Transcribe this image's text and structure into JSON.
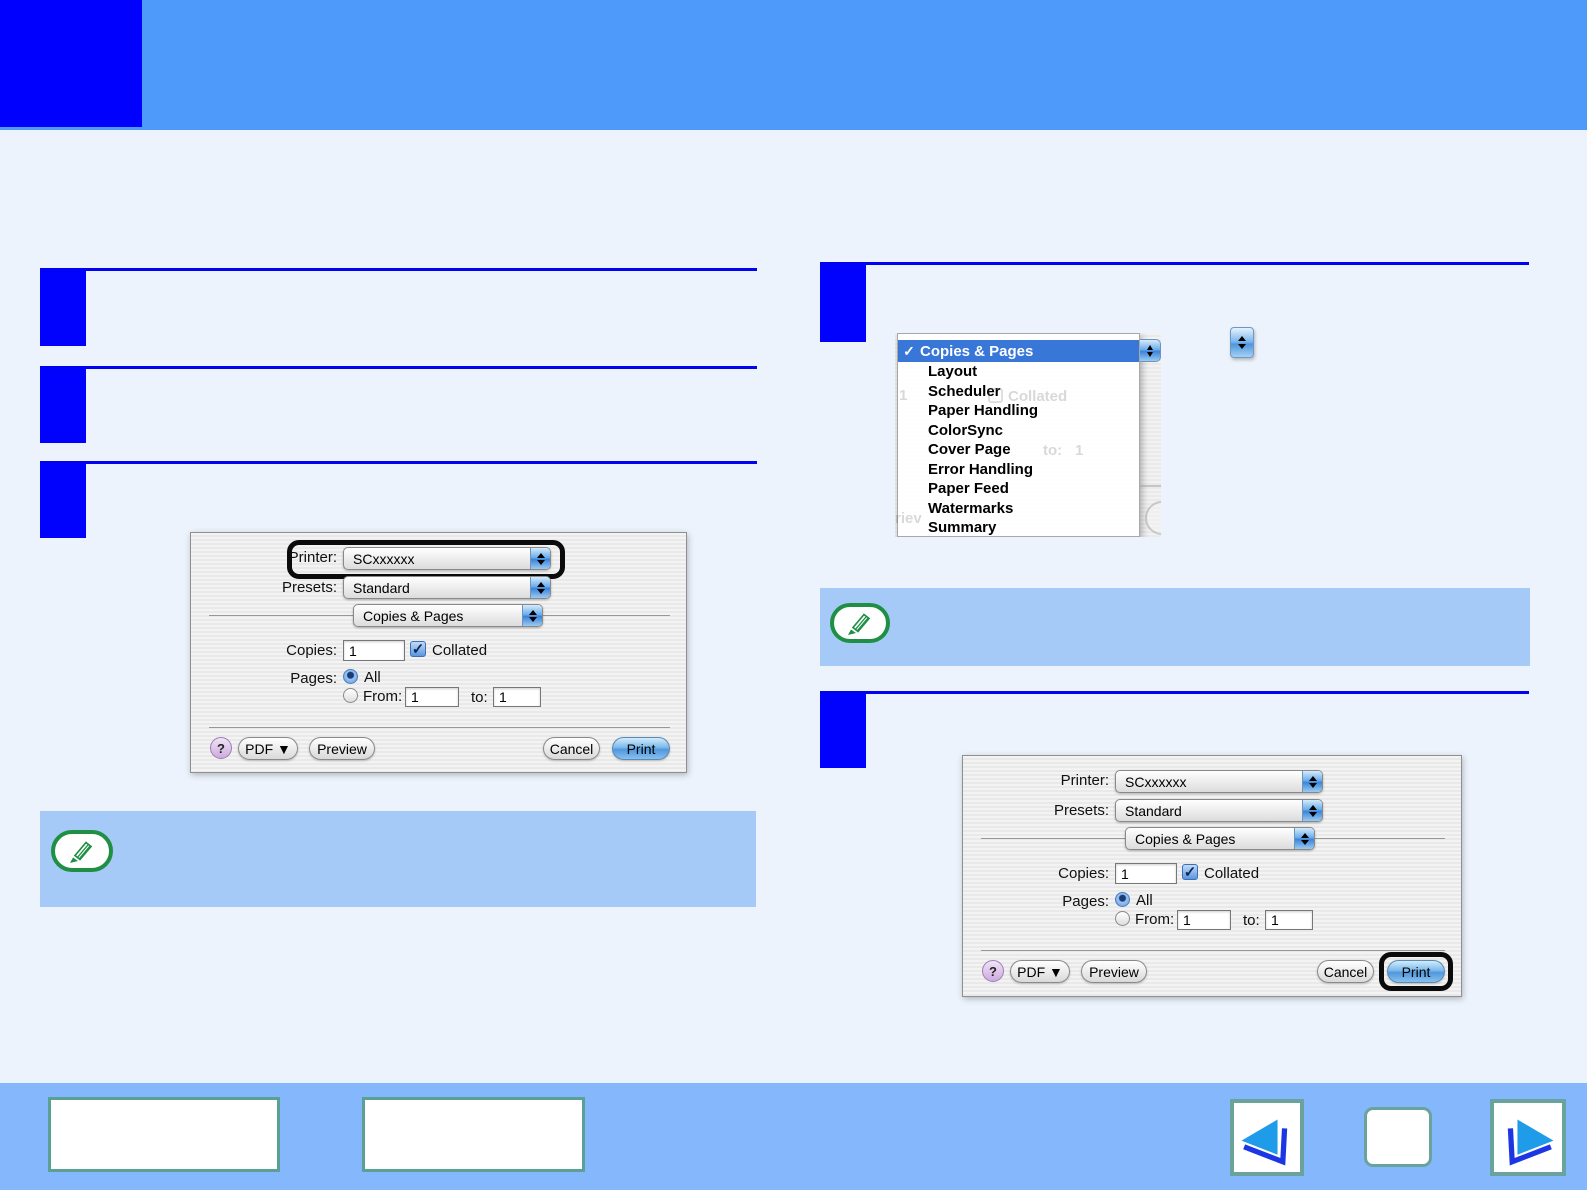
{
  "page": {
    "header_bar_color": "#4D9AFA",
    "header_block_color": "#0000FF",
    "background_color": "#EDF3FC",
    "footer_bar_color": "#85B7FC",
    "note_box_color": "#A6CAF8",
    "step_marker_color": "#0102FD"
  },
  "print_dialog": {
    "printer_label": "Printer:",
    "printer_value": "SCxxxxxx",
    "presets_label": "Presets:",
    "presets_value": "Standard",
    "pane_value": "Copies & Pages",
    "copies_label": "Copies:",
    "copies_value": "1",
    "collated_check": "✓",
    "collated_label": "Collated",
    "pages_label": "Pages:",
    "all_label": "All",
    "from_label": "From:",
    "from_value": "1",
    "to_label": "to:",
    "to_value": "1",
    "help_label": "?",
    "pdf_label": "PDF ▼",
    "preview_label": "Preview",
    "cancel_label": "Cancel",
    "print_label": "Print"
  },
  "pane_menu": {
    "checkmark": "✓",
    "selected_item": "Copies & Pages",
    "items": [
      "Layout",
      "Scheduler",
      "Paper Handling",
      "ColorSync",
      "Cover Page",
      "Error Handling",
      "Paper Feed",
      "Watermarks",
      "Summary"
    ],
    "ghost": {
      "one_left": "1",
      "collated": "Collated",
      "to": "to:",
      "one": "1",
      "riev": "riev"
    }
  }
}
